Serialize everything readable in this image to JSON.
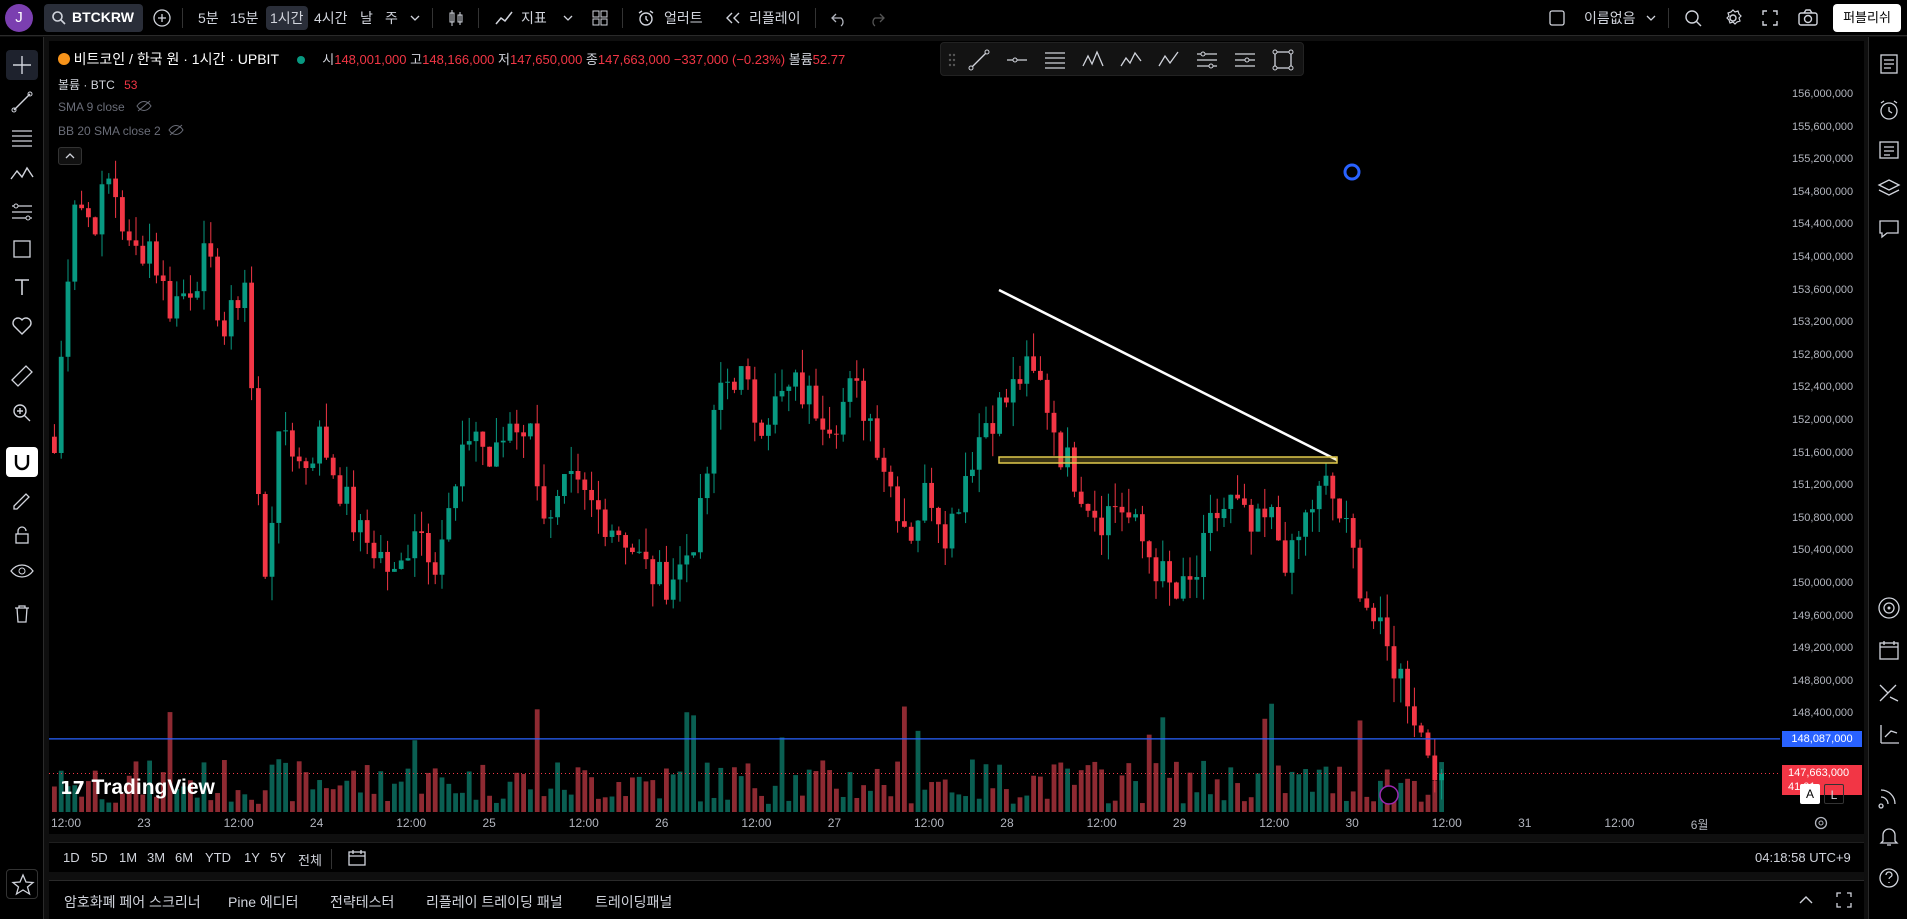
{
  "app": {
    "avatar_letter": "J",
    "symbol": "BTCKRW",
    "publish": "퍼블리쉬",
    "layout_name": "이름없음"
  },
  "intervals": [
    "5분",
    "15분",
    "1시간",
    "4시간",
    "날",
    "주"
  ],
  "active_interval": "1시간",
  "toolbar": {
    "indicators": "지표",
    "alert": "얼러트",
    "replay": "리플레이"
  },
  "legend": {
    "title": "비트코인 / 한국 원 · 1시간 · UPBIT",
    "o_label": "시",
    "o": "148,001,000",
    "h_label": "고",
    "h": "148,166,000",
    "l_label": "저",
    "l": "147,650,000",
    "c_label": "종",
    "c": "147,663,000",
    "change": "−337,000 (−0.23%)",
    "vol_label": "볼륨",
    "vol": "52.77",
    "volume_title": "볼륨 · BTC",
    "volume_value": "53",
    "sma": "SMA 9 close",
    "bb": "BB 20 SMA close 2"
  },
  "price_axis": {
    "ticks": [
      "156,000,000",
      "155,600,000",
      "155,200,000",
      "154,800,000",
      "154,400,000",
      "154,000,000",
      "153,600,000",
      "153,200,000",
      "152,800,000",
      "152,400,000",
      "152,000,000",
      "151,600,000",
      "151,200,000",
      "150,800,000",
      "150,400,000",
      "150,000,000",
      "149,600,000",
      "149,200,000",
      "148,800,000",
      "148,400,000"
    ],
    "line_price": "148,087,000",
    "last_price": "147,663,000",
    "countdown": "41:01"
  },
  "time_axis": [
    "12:00",
    "23",
    "12:00",
    "24",
    "12:00",
    "25",
    "12:00",
    "26",
    "12:00",
    "27",
    "12:00",
    "28",
    "12:00",
    "29",
    "12:00",
    "30",
    "12:00",
    "31",
    "12:00",
    "6월"
  ],
  "chart_data": {
    "type": "candlestick",
    "symbol": "BTCKRW",
    "interval": "1시간",
    "ylim": [
      148000000,
      156200000
    ],
    "horizontal_line": 148087000,
    "last_close": 147663000,
    "anchor_closes": [
      151600000,
      154800000,
      154400000,
      155000000,
      154000000,
      154200000,
      153400000,
      153600000,
      154000000,
      153000000,
      153800000,
      150000000,
      152000000,
      151400000,
      151800000,
      151200000,
      150600000,
      150400000,
      150000000,
      150800000,
      150300000,
      151000000,
      152000000,
      151400000,
      152000000,
      151900000,
      150600000,
      151200000,
      151000000,
      150800000,
      150600000,
      150200000,
      150000000,
      150200000,
      150800000,
      152400000,
      152600000,
      152000000,
      152200000,
      152400000,
      152200000,
      152000000,
      152400000,
      152000000,
      151200000,
      150600000,
      151200000,
      150600000,
      151400000,
      152000000,
      152200000,
      152600000,
      152400000,
      151600000,
      151200000,
      150800000,
      151000000,
      150600000,
      150200000,
      149800000,
      150000000,
      150800000,
      151000000,
      150600000,
      150800000,
      150200000,
      150900000,
      151200000,
      150600000,
      149800000,
      149200000,
      148800000,
      148100000,
      147663000
    ]
  },
  "markers": {
    "logo": "TradingView"
  },
  "range": [
    "1D",
    "5D",
    "1M",
    "3M",
    "6M",
    "YTD",
    "1Y",
    "5Y",
    "전체"
  ],
  "clock": "04:18:58 UTC+9",
  "bottom_tabs": [
    "암호화폐 페어 스크리너",
    "Pine 에디터",
    "전략테스터",
    "리플레이 트레이딩 패널",
    "트레이딩패널"
  ],
  "colors": {
    "up": "#089981",
    "down": "#f23645",
    "hline": "#2962ff",
    "trend": "#ffffff",
    "rect": "#e0c94c"
  }
}
